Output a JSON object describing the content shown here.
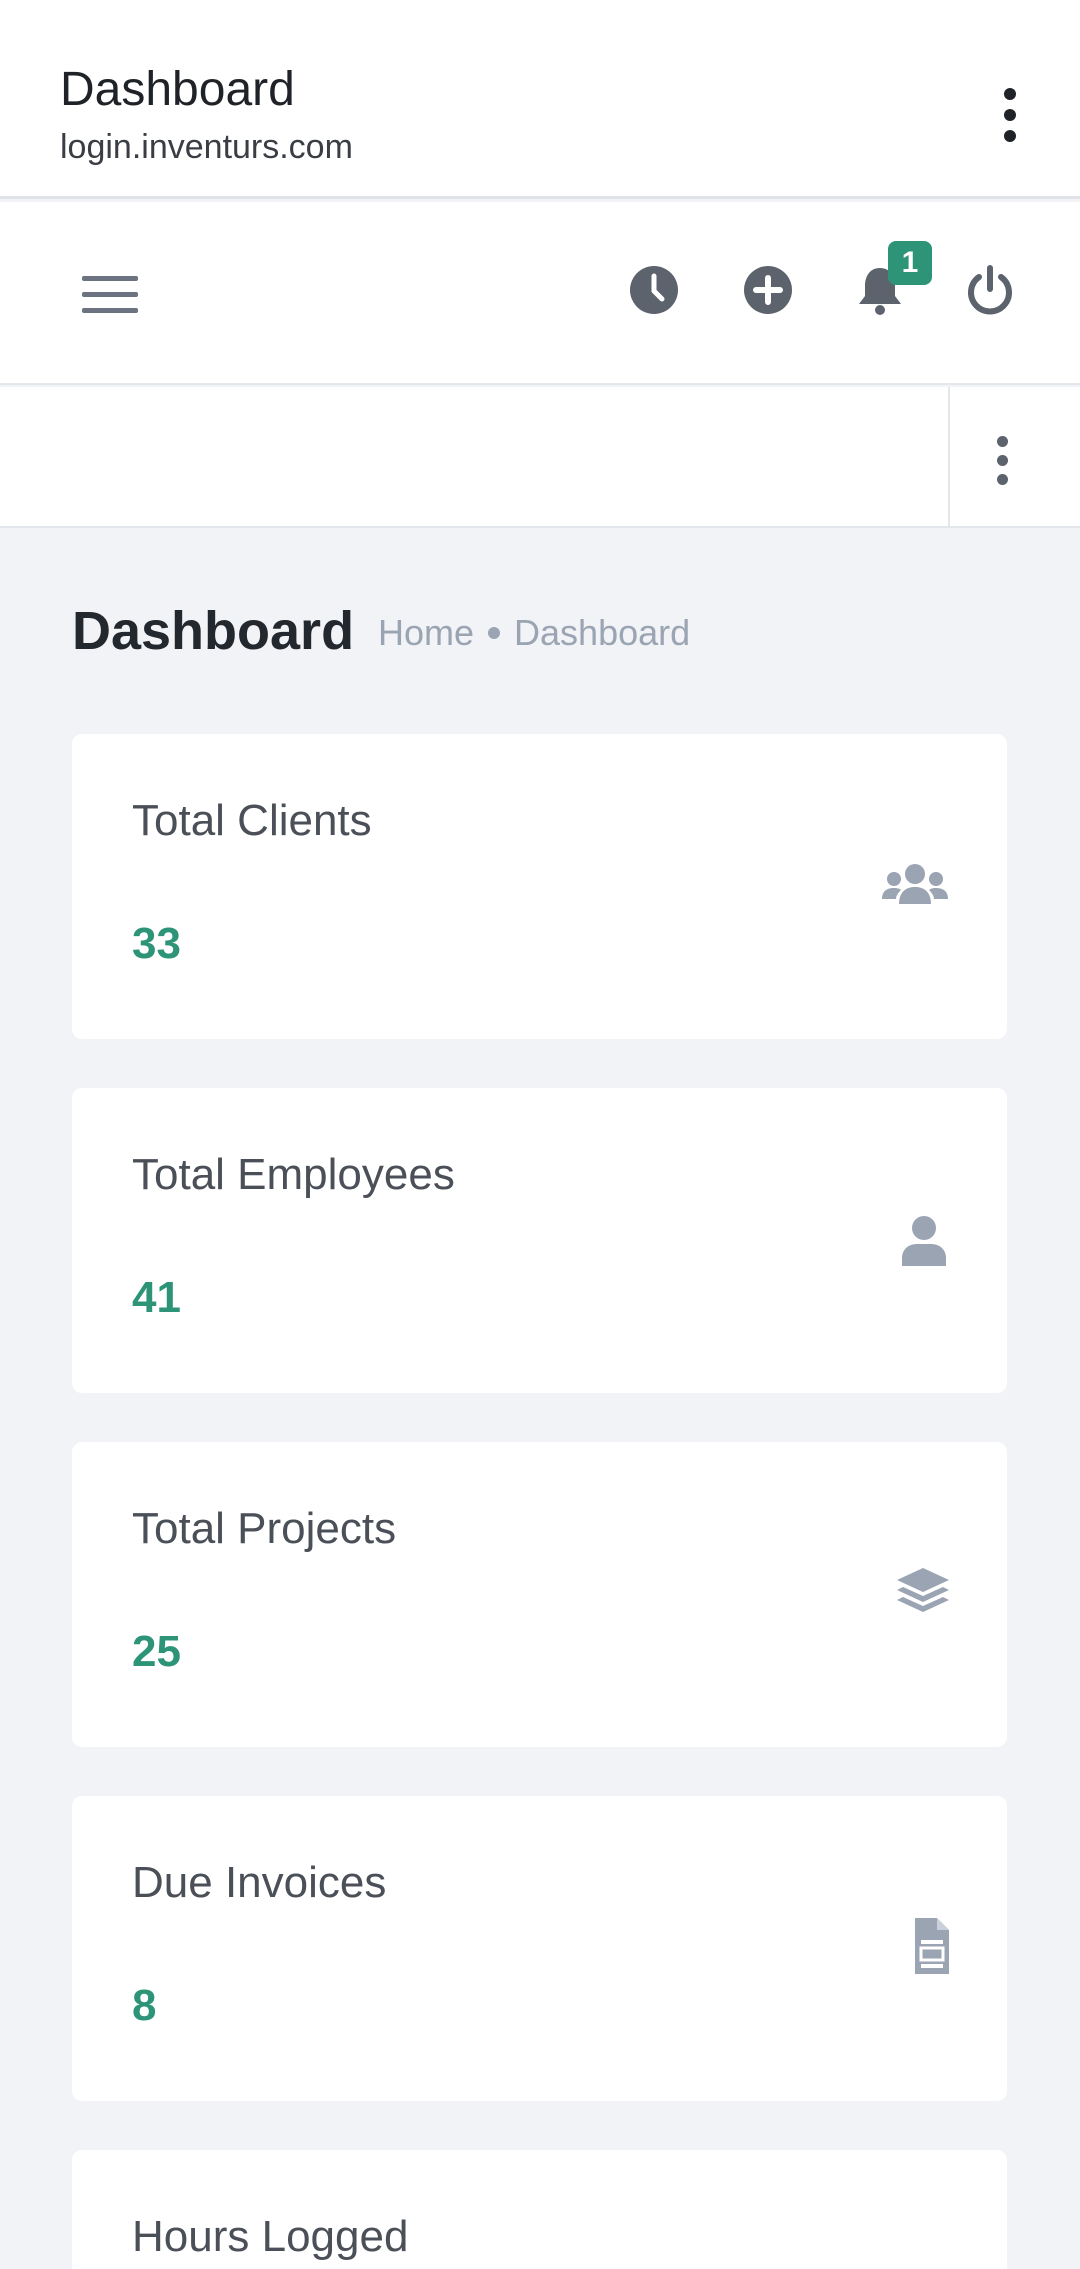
{
  "browser": {
    "title": "Dashboard",
    "url": "login.inventurs.com"
  },
  "header": {
    "notification_count": "1",
    "icons": [
      "menu-icon",
      "clock-icon",
      "plus-circle-icon",
      "bell-icon",
      "power-icon"
    ]
  },
  "page": {
    "title": "Dashboard",
    "breadcrumb": [
      "Home",
      "Dashboard"
    ]
  },
  "cards": [
    {
      "label": "Total Clients",
      "value": "33",
      "icon": "users-icon"
    },
    {
      "label": "Total Employees",
      "value": "41",
      "icon": "user-icon"
    },
    {
      "label": "Total Projects",
      "value": "25",
      "icon": "layers-icon"
    },
    {
      "label": "Due Invoices",
      "value": "8",
      "icon": "file-invoice-icon"
    },
    {
      "label": "Hours Logged",
      "value": "",
      "icon": ""
    }
  ],
  "colors": {
    "accent": "#2e9478",
    "icon_gray": "#5c636d",
    "card_icon": "#9aa4b2",
    "background": "#f1f3f6"
  }
}
